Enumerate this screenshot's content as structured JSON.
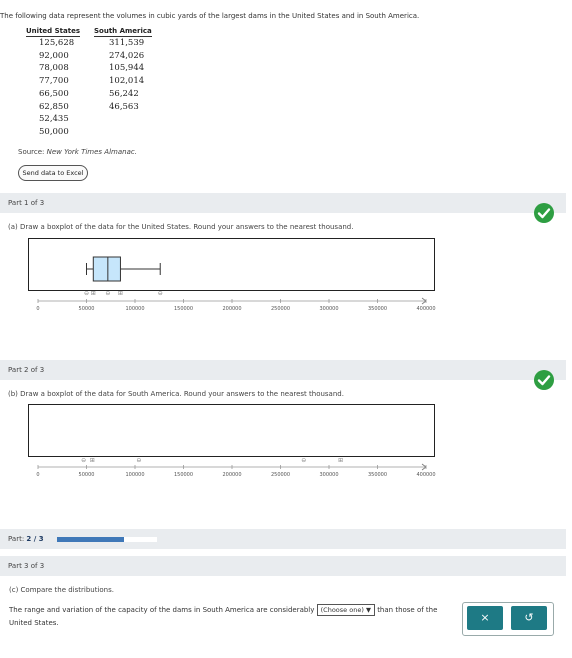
{
  "intro": "The following data represent the volumes in cubic yards of the largest dams in the United States and in South America.",
  "table": {
    "headers": [
      "United States",
      "South America"
    ],
    "us": [
      "125,628",
      "92,000",
      "78,008",
      "77,700",
      "66,500",
      "62,850",
      "52,435",
      "50,000"
    ],
    "sa": [
      "311,539",
      "274,026",
      "105,944",
      "102,014",
      "56,242",
      "46,563"
    ]
  },
  "source_label": "Source:",
  "source_name": "New York Times Almanac.",
  "excel_button": "Send data to Excel",
  "part1": {
    "title": "Part 1 of 3",
    "question": "(a) Draw a boxplot of the data for the United States. Round your answers to the nearest thousand.",
    "box": {
      "min": 50000,
      "q1": 57000,
      "median": 72000,
      "q3": 85000,
      "max": 126000
    },
    "tool_glyphs": [
      {
        "x": 50000,
        "glyph": "⊖"
      },
      {
        "x": 57000,
        "glyph": "⊞"
      },
      {
        "x": 72000,
        "glyph": "⊖"
      },
      {
        "x": 85000,
        "glyph": "⊞"
      },
      {
        "x": 126000,
        "glyph": "⊖"
      }
    ]
  },
  "part2": {
    "title": "Part 2 of 3",
    "question": "(b) Draw a boxplot of the data for South America. Round your answers to the nearest thousand.",
    "box": {
      "min": 47000,
      "q1": 56000,
      "median": 104000,
      "q3": 274000,
      "max": 312000
    },
    "tool_glyphs": [
      {
        "x": 47000,
        "glyph": "⊖"
      },
      {
        "x": 56000,
        "glyph": "⊞"
      },
      {
        "x": 104000,
        "glyph": "⊖"
      },
      {
        "x": 274000,
        "glyph": "⊖"
      },
      {
        "x": 312000,
        "glyph": "⊞"
      }
    ]
  },
  "axis": {
    "xlim": [
      0,
      400000
    ],
    "ticks": [
      0,
      50000,
      100000,
      150000,
      200000,
      250000,
      300000,
      350000,
      400000
    ],
    "tick_labels": [
      "0",
      "50000",
      "100000",
      "150000",
      "200000",
      "250000",
      "300000",
      "350000",
      "400000"
    ]
  },
  "progress": {
    "label": "Part:",
    "value": "2 / 3",
    "fraction": 0.667
  },
  "part3": {
    "title": "Part 3 of 3",
    "question": "(c) Compare the distributions.",
    "sentence_start": "The range and variation of the capacity of the dams in South America are considerably",
    "dropdown": "(Choose one)",
    "sentence_end": "than those of the United States."
  },
  "buttons": {
    "clear": "×",
    "undo": "↺"
  },
  "colors": {
    "box_fill": "#c6e6fb",
    "check_green": "#2e9e42",
    "action_teal": "#1e7a85",
    "progress_fill": "#3f78b8"
  }
}
